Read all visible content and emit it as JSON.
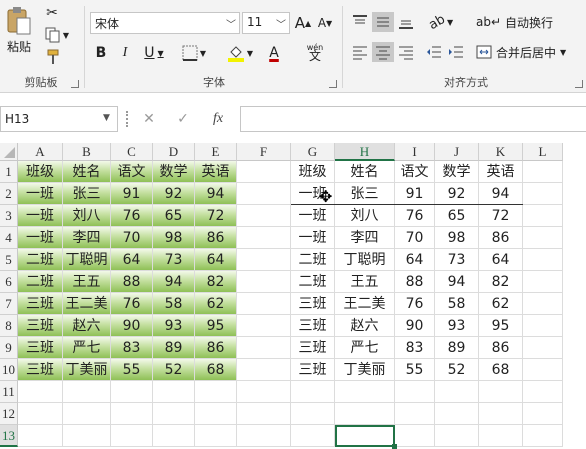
{
  "ribbon": {
    "clipboard": {
      "paste_label": "粘贴",
      "group_label": "剪贴板"
    },
    "font": {
      "font_name": "宋体",
      "font_size": "11",
      "group_label": "字体",
      "bold": "B",
      "italic": "I",
      "underline": "U",
      "grow": "A",
      "shrink": "A",
      "font_color": "A",
      "phonetic_label": "wén"
    },
    "alignment": {
      "wrap_label": "自动换行",
      "merge_label": "合并后居中",
      "group_label": "对齐方式"
    }
  },
  "formula_bar": {
    "name_box": "H13",
    "fx": "fx",
    "value": ""
  },
  "colors": {
    "accent": "#217346",
    "header_bg": "#f2f2f2",
    "grid": "#dcdcdc"
  },
  "sheet": {
    "columns": [
      "A",
      "B",
      "C",
      "D",
      "E",
      "F",
      "G",
      "H",
      "I",
      "J",
      "K",
      "L"
    ],
    "rows": [
      "1",
      "2",
      "3",
      "4",
      "5",
      "6",
      "7",
      "8",
      "9",
      "10",
      "11",
      "12",
      "13"
    ],
    "selected_cell": "H13",
    "left_table": [
      [
        "班级",
        "姓名",
        "语文",
        "数学",
        "英语"
      ],
      [
        "一班",
        "张三",
        "91",
        "92",
        "94"
      ],
      [
        "一班",
        "刘八",
        "76",
        "65",
        "72"
      ],
      [
        "一班",
        "李四",
        "70",
        "98",
        "86"
      ],
      [
        "二班",
        "丁聪明",
        "64",
        "73",
        "64"
      ],
      [
        "二班",
        "王五",
        "88",
        "94",
        "82"
      ],
      [
        "三班",
        "王二美",
        "76",
        "58",
        "62"
      ],
      [
        "三班",
        "赵六",
        "90",
        "93",
        "95"
      ],
      [
        "三班",
        "严七",
        "83",
        "89",
        "86"
      ],
      [
        "三班",
        "丁美丽",
        "55",
        "52",
        "68"
      ]
    ],
    "right_table": [
      [
        "班级",
        "姓名",
        "语文",
        "数学",
        "英语"
      ],
      [
        "一班",
        "张三",
        "91",
        "92",
        "94"
      ],
      [
        "一班",
        "刘八",
        "76",
        "65",
        "72"
      ],
      [
        "一班",
        "李四",
        "70",
        "98",
        "86"
      ],
      [
        "二班",
        "丁聪明",
        "64",
        "73",
        "64"
      ],
      [
        "二班",
        "王五",
        "88",
        "94",
        "82"
      ],
      [
        "三班",
        "王二美",
        "76",
        "58",
        "62"
      ],
      [
        "三班",
        "赵六",
        "90",
        "93",
        "95"
      ],
      [
        "三班",
        "严七",
        "83",
        "89",
        "86"
      ],
      [
        "三班",
        "丁美丽",
        "55",
        "52",
        "68"
      ]
    ]
  }
}
